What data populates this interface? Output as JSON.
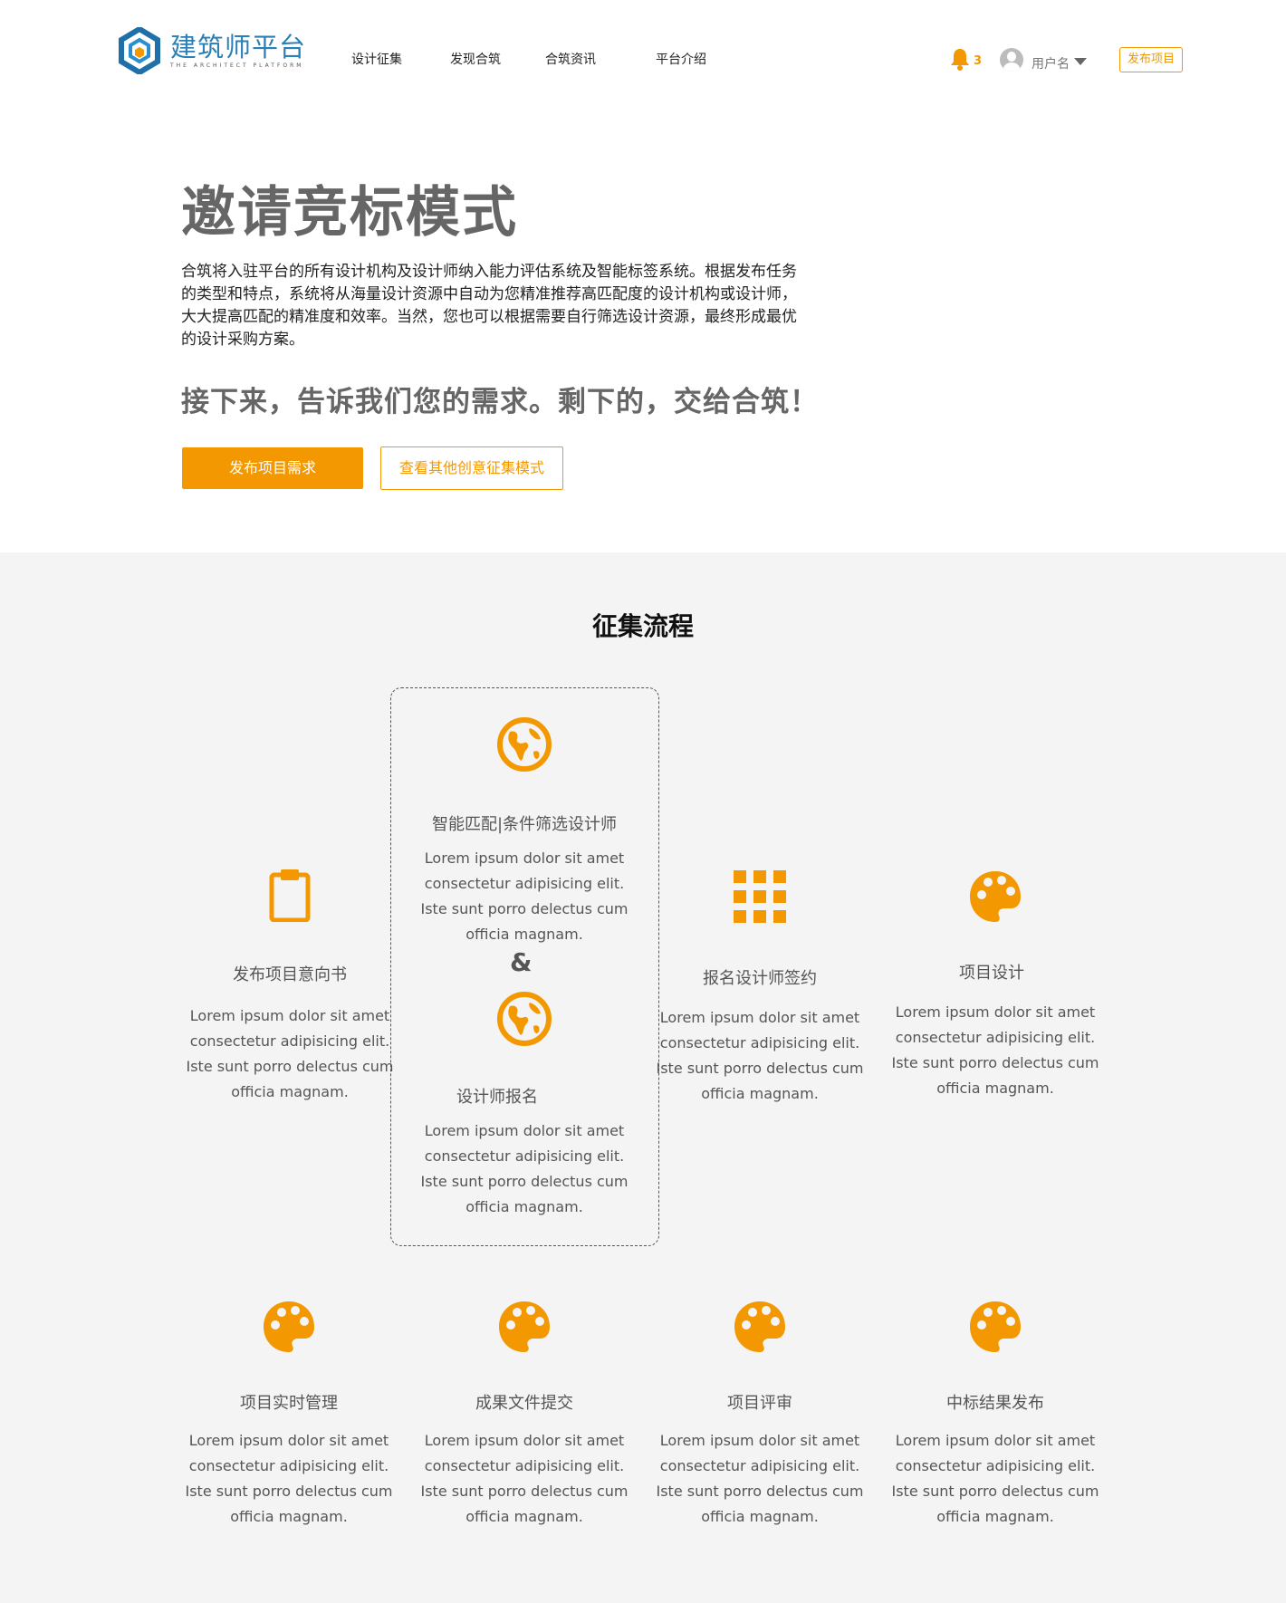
{
  "header": {
    "logo_cn": "建筑师平台",
    "logo_en": "THE ARCHITECT PLATFORM",
    "nav": [
      "设计征集",
      "发现合筑",
      "合筑资讯",
      "平台介绍"
    ],
    "notification_count": "3",
    "username": "用户名",
    "publish_label": "发布项目"
  },
  "hero": {
    "title": "邀请竞标模式",
    "description": "合筑将入驻平台的所有设计机构及设计师纳入能力评估系统及智能标签系统。根据发布任务的类型和特点，系统将从海量设计资源中自动为您精准推荐高匹配度的设计机构或设计师，大大提高匹配的精准度和效率。当然，您也可以根据需要自行筛选设计资源，最终形成最优的设计采购方案。",
    "subtitle": "接下来，告诉我们您的需求。剩下的，交给合筑！",
    "primary_button": "发布项目需求",
    "secondary_button": "查看其他创意征集模式"
  },
  "process": {
    "title": "征集流程",
    "amp": "&",
    "steps": [
      {
        "name": "发布项目意向书",
        "icon": "clipboard-icon",
        "text": "Lorem ipsum dolor sit amet consectetur adipisicing elit. Iste sunt porro delectus cum officia magnam."
      },
      {
        "name": "智能匹配|条件筛选设计师",
        "icon": "globe-icon",
        "text": "Lorem ipsum dolor sit amet consectetur adipisicing elit. Iste sunt porro delectus cum officia magnam."
      },
      {
        "name": "设计师报名",
        "icon": "globe-icon",
        "text": "Lorem ipsum dolor sit amet consectetur adipisicing elit. Iste sunt porro delectus cum officia magnam."
      },
      {
        "name": "报名设计师签约",
        "icon": "grid-icon",
        "text": "Lorem ipsum dolor sit amet consectetur adipisicing elit. Iste sunt porro delectus cum officia magnam."
      },
      {
        "name": "项目设计",
        "icon": "palette-icon",
        "text": "Lorem ipsum dolor sit amet consectetur adipisicing elit. Iste sunt porro delectus cum officia magnam."
      },
      {
        "name": "项目实时管理",
        "icon": "palette-icon",
        "text": "Lorem ipsum dolor sit amet consectetur adipisicing elit. Iste sunt porro delectus cum officia magnam."
      },
      {
        "name": "成果文件提交",
        "icon": "palette-icon",
        "text": "Lorem ipsum dolor sit amet consectetur adipisicing elit. Iste sunt porro delectus cum officia magnam."
      },
      {
        "name": "项目评审",
        "icon": "palette-icon",
        "text": "Lorem ipsum dolor sit amet consectetur adipisicing elit. Iste sunt porro delectus cum officia magnam."
      },
      {
        "name": "中标结果发布",
        "icon": "palette-icon",
        "text": "Lorem ipsum dolor sit amet consectetur adipisicing elit. Iste sunt porro delectus cum officia magnam."
      }
    ]
  },
  "colors": {
    "accent": "#f39800",
    "logo_blue": "#2a7fb5",
    "section_bg": "#f4f4f4"
  }
}
